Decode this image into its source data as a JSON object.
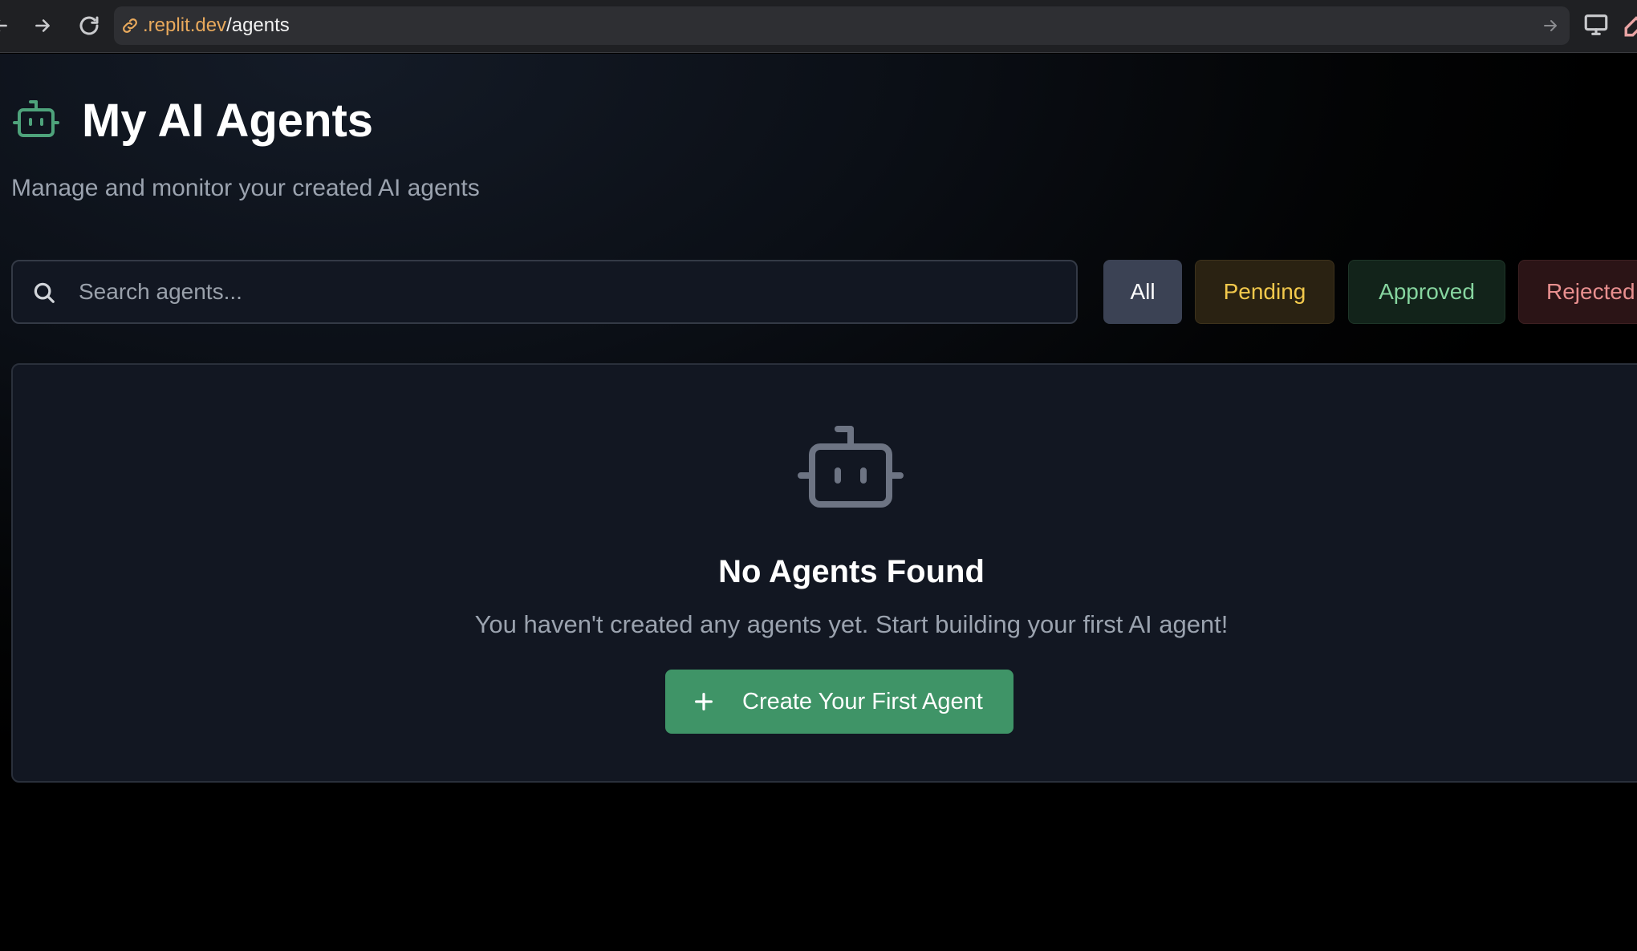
{
  "browser": {
    "url_domain": ".replit.dev",
    "url_path": "/agents",
    "icons": {
      "back": "arrow-left-icon",
      "forward": "arrow-right-icon",
      "reload": "reload-icon",
      "link": "link-icon",
      "go": "arrow-right-icon",
      "screen": "monitor-icon",
      "extension": "dropper-icon"
    }
  },
  "header": {
    "title": "My AI Agents",
    "subtitle": "Manage and monitor your created AI agents",
    "icon": "robot-icon"
  },
  "search": {
    "placeholder": "Search agents...",
    "value": ""
  },
  "filters": [
    {
      "label": "All",
      "selected": true
    },
    {
      "label": "Pending",
      "selected": false
    },
    {
      "label": "Approved",
      "selected": false
    },
    {
      "label": "Rejected",
      "selected": false
    }
  ],
  "empty_state": {
    "icon": "robot-icon",
    "title": "No Agents Found",
    "message": "You haven't created any agents yet. Start building your first AI agent!",
    "button_label": "Create Your First Agent"
  },
  "colors": {
    "accent_green": "#3f9467",
    "pending": "#f3c94c",
    "approved": "#86d59f",
    "rejected": "#e88f8f",
    "url_domain": "#e8a95c"
  }
}
